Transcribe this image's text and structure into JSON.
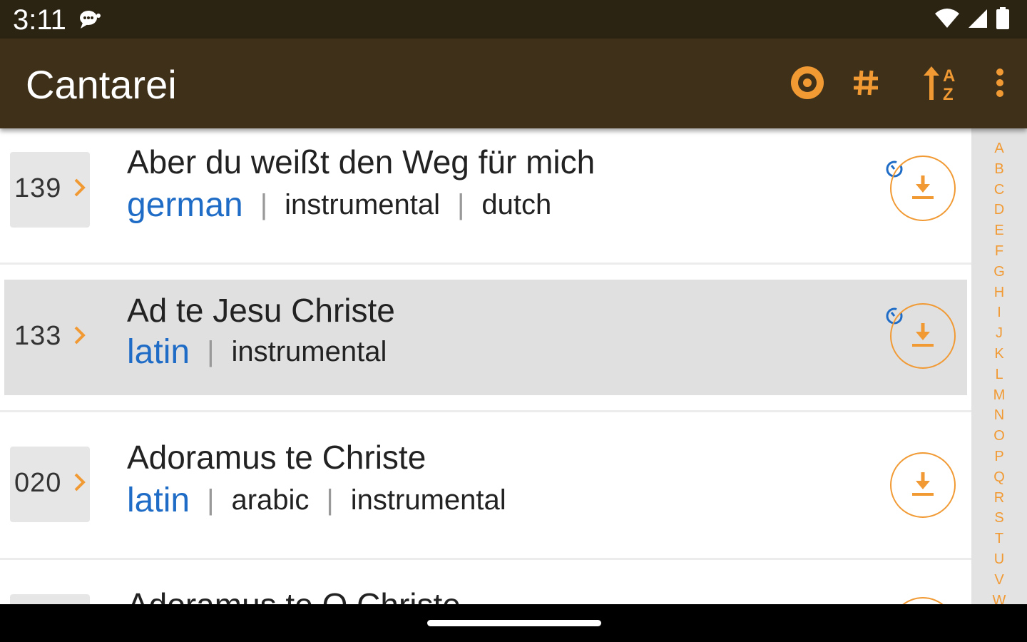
{
  "status_bar": {
    "time": "3:11"
  },
  "app_bar": {
    "title": "Cantarei",
    "actions": [
      "record-icon",
      "hash-icon",
      "sort-az-icon",
      "more-vert-icon"
    ]
  },
  "colors": {
    "accent": "#f19a34",
    "language": "#1f6cc7",
    "appbar": "#3e3019",
    "statusbar": "#2c2413"
  },
  "songs": [
    {
      "number": "139",
      "title": "Aber du weißt den Weg für mich",
      "language": "german",
      "tags": [
        "instrumental",
        "dutch"
      ],
      "timer": true
    },
    {
      "number": "133",
      "title": "Ad te Jesu Christe",
      "language": "latin",
      "tags": [
        "instrumental"
      ],
      "timer": true,
      "selected": true
    },
    {
      "number": "020",
      "title": "Adoramus te Christe",
      "language": "latin",
      "tags": [
        "arabic",
        "instrumental"
      ],
      "timer": false
    },
    {
      "number": "",
      "title": "Adoramus te O Christe",
      "language": "",
      "tags": [],
      "timer": false
    }
  ],
  "alphabet": [
    "A",
    "B",
    "C",
    "D",
    "E",
    "F",
    "G",
    "H",
    "I",
    "J",
    "K",
    "L",
    "M",
    "N",
    "O",
    "P",
    "Q",
    "R",
    "S",
    "T",
    "U",
    "V",
    "W"
  ]
}
